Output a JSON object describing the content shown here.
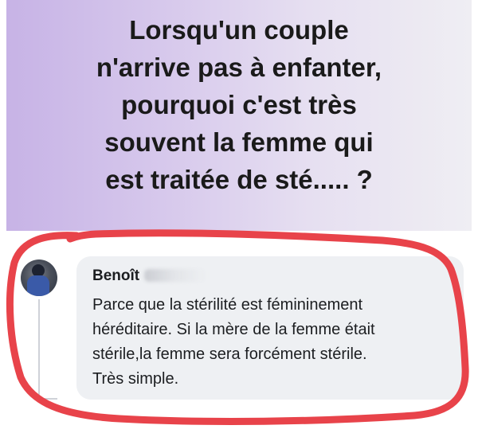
{
  "post": {
    "lines": [
      "Lorsqu'un couple",
      "n'arrive pas à enfanter,",
      "pourquoi c'est très",
      "souvent la femme qui",
      "est traitée de sté..... ?"
    ],
    "background_colors": [
      "#c7b3e6",
      "#efeef3"
    ]
  },
  "comment": {
    "author_visible": "Benoît",
    "author_surname_obscured": true,
    "lines": [
      "Parce que la stérilité est fémininement",
      "héréditaire. Si la mère de la femme était",
      "stérile,la femme sera forcément stérile.",
      "Très simple."
    ],
    "bubble_color": "#eef0f3"
  },
  "annotation": {
    "type": "hand-drawn-circle",
    "color": "#e8434a"
  }
}
